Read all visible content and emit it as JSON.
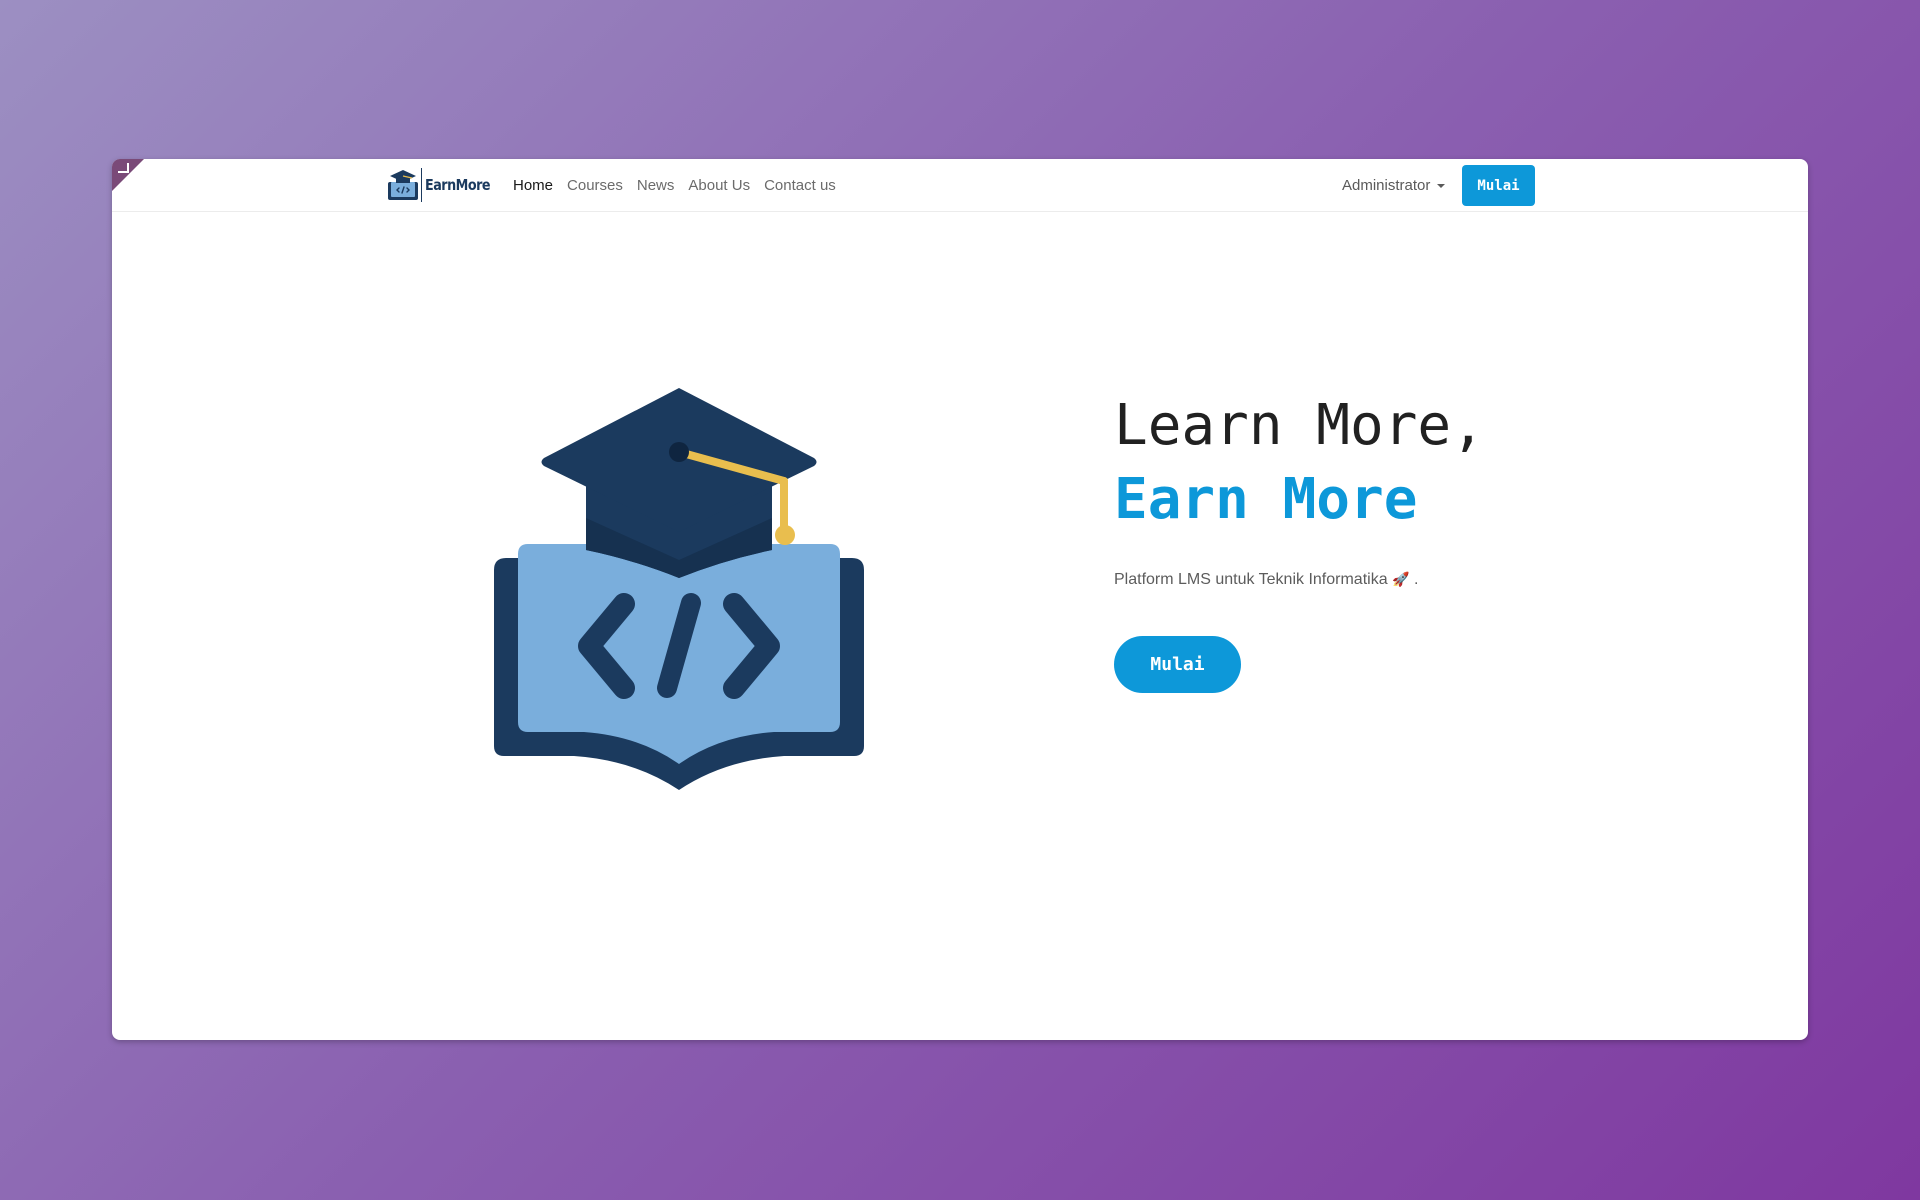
{
  "colors": {
    "accent": "#0d98d9",
    "navy": "#1b3a5e",
    "book_light": "#7aaedc",
    "tassel": "#e9be4e"
  },
  "window": {
    "corner_icon": "resize-corner-icon"
  },
  "navbar": {
    "brand_text": "EarnMore",
    "brand_icon": "graduation-book-logo-icon",
    "links": [
      "Home",
      "Courses",
      "News",
      "About Us",
      "Contact us"
    ],
    "active_link": "Home",
    "user_menu_label": "Administrator",
    "user_menu_icon": "caret-down-icon",
    "cta_label": "Mulai"
  },
  "hero": {
    "illustration_icon": "graduation-cap-code-book-icon",
    "title_line1": "Learn More,",
    "title_line2": "Earn More",
    "subtitle": "Platform LMS untuk Teknik Informatika",
    "subtitle_emoji": "🚀",
    "subtitle_end": ".",
    "cta_label": "Mulai"
  }
}
